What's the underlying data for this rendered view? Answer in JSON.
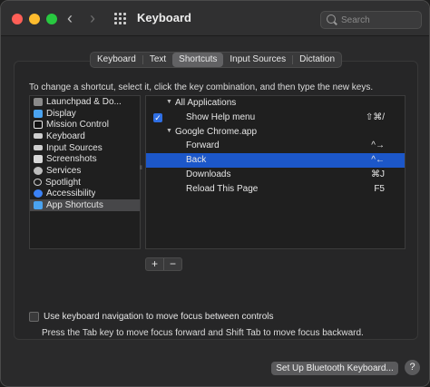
{
  "window": {
    "title": "Keyboard"
  },
  "search": {
    "placeholder": "Search"
  },
  "tabs": [
    {
      "label": "Keyboard",
      "active": false
    },
    {
      "label": "Text",
      "active": false
    },
    {
      "label": "Shortcuts",
      "active": true
    },
    {
      "label": "Input Sources",
      "active": false
    },
    {
      "label": "Dictation",
      "active": false
    }
  ],
  "instructions": "To change a shortcut, select it, click the key combination, and then type the new keys.",
  "categories": [
    {
      "label": "Launchpad & Do...",
      "icon": "launchpad-icon",
      "color": "#8a8a8a",
      "selected": false
    },
    {
      "label": "Display",
      "icon": "display-icon",
      "color": "#4aa3f0",
      "selected": false
    },
    {
      "label": "Mission Control",
      "icon": "mission-control-icon",
      "color": "#eaeaea",
      "selected": false
    },
    {
      "label": "Keyboard",
      "icon": "keyboard-icon",
      "color": "#cfcfcf",
      "selected": false
    },
    {
      "label": "Input Sources",
      "icon": "input-sources-icon",
      "color": "#cfcfcf",
      "selected": false
    },
    {
      "label": "Screenshots",
      "icon": "screenshots-icon",
      "color": "#d8d8d8",
      "selected": false
    },
    {
      "label": "Services",
      "icon": "services-icon",
      "color": "#bdbdbd",
      "selected": false
    },
    {
      "label": "Spotlight",
      "icon": "spotlight-icon",
      "color": "#d0d0d0",
      "selected": false
    },
    {
      "label": "Accessibility",
      "icon": "accessibility-icon",
      "color": "#3b82f6",
      "selected": false
    },
    {
      "label": "App Shortcuts",
      "icon": "app-shortcuts-icon",
      "color": "#4aa3f0",
      "selected": true
    }
  ],
  "shortcuts": {
    "all_apps": {
      "label": "All Applications"
    },
    "show_help": {
      "label": "Show Help menu",
      "key": "⇧⌘/",
      "checked": true
    },
    "chrome": {
      "label": "Google Chrome.app"
    },
    "forward": {
      "label": "Forward",
      "key": "^→"
    },
    "back": {
      "label": "Back",
      "key": "^←",
      "selected": true
    },
    "downloads": {
      "label": "Downloads",
      "key": "⌘J"
    },
    "reload": {
      "label": "Reload This Page",
      "key": "F5"
    }
  },
  "buttons": {
    "add": "+",
    "remove": "−",
    "bluetooth": "Set Up Bluetooth Keyboard...",
    "help": "?"
  },
  "keyboard_nav": {
    "label": "Use keyboard navigation to move focus between controls",
    "checked": false,
    "hint": "Press the Tab key to move focus forward and Shift Tab to move focus backward."
  },
  "colors": {
    "accent": "#1c57c9",
    "close": "#ff5f57",
    "minimize": "#febc2e",
    "zoom": "#28c840"
  }
}
